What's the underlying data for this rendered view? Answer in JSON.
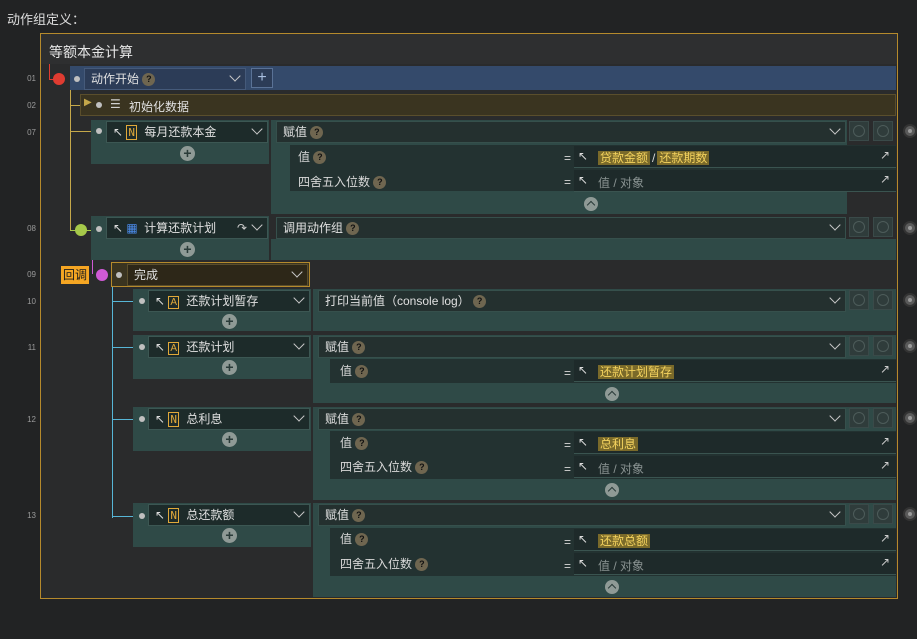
{
  "panel": {
    "title": "动作组定义："
  },
  "group": {
    "title": "等额本金计算"
  },
  "colors": {
    "accent": "#e0a93a",
    "frame": "#b58a2c",
    "start_node": "#e03c31",
    "sub_node": "#a6c94a",
    "callback_node": "#d05ad6",
    "callback_badge": "#f5a623"
  },
  "rows": [
    {
      "num": "01",
      "label": "动作开始",
      "action": "",
      "add_label": "+"
    },
    {
      "num": "02",
      "label": "初始化数据"
    },
    {
      "num": "07",
      "label": "每月还款本金",
      "action": "赋值",
      "params": [
        {
          "name": "值",
          "expr": [
            "贷款金额",
            "/",
            "还款期数"
          ]
        },
        {
          "name": "四舍五入位数",
          "placeholder": "值 / 对象"
        }
      ]
    },
    {
      "num": "08",
      "label": "计算还款计划",
      "action": "调用动作组"
    },
    {
      "num": "09",
      "label": "完成",
      "badge": "回调"
    },
    {
      "num": "10",
      "label": "还款计划暂存",
      "action": "打印当前值（console log）"
    },
    {
      "num": "11",
      "label": "还款计划",
      "action": "赋值",
      "params": [
        {
          "name": "值",
          "expr": [
            "还款计划暂存"
          ]
        }
      ]
    },
    {
      "num": "12",
      "label": "总利息",
      "action": "赋值",
      "params": [
        {
          "name": "值",
          "expr": [
            "总利息"
          ]
        },
        {
          "name": "四舍五入位数",
          "placeholder": "值 / 对象"
        }
      ]
    },
    {
      "num": "13",
      "label": "总还款额",
      "action": "赋值",
      "params": [
        {
          "name": "值",
          "expr": [
            "还款总额"
          ]
        },
        {
          "name": "四舍五入位数",
          "placeholder": "值 / 对象"
        }
      ]
    }
  ],
  "eq": "=",
  "q": "?"
}
